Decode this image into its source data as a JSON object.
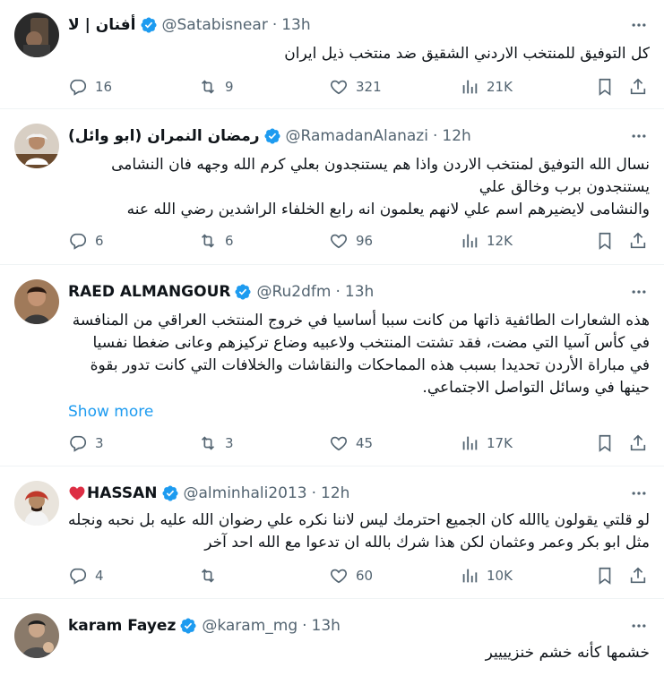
{
  "colors": {
    "accent": "#1d9bf0",
    "secondary_text": "#536471",
    "divider": "#eff3f4",
    "heart": "#f91880"
  },
  "tweets": [
    {
      "display_name": "أفنان | لا",
      "handle": "@Satabisnear",
      "dot": "·",
      "time": "13h",
      "text": "كل التوفيق للمنتخب الاردني الشقيق ضد منتخب ذيل ايران",
      "show_more": "",
      "replies": "16",
      "retweets": "9",
      "likes": "321",
      "views": "21K"
    },
    {
      "display_name": "رمضان النمران (ابو وائل)",
      "handle": "@RamadanAlanazi",
      "dot": "·",
      "time": "12h",
      "text": "نسال الله التوفيق لمنتخب الاردن واذا هم يستنجدون بعلي كرم الله وجهه فان النشامى يستنجدون برب وخالق علي\nوالنشامى لايضيرهم اسم علي لانهم يعلمون انه رابع الخلفاء الراشدين رضي الله عنه",
      "show_more": "",
      "replies": "6",
      "retweets": "6",
      "likes": "96",
      "views": "12K"
    },
    {
      "display_name": "RAED ALMANGOUR",
      "handle": "@Ru2dfm",
      "dot": "·",
      "time": "13h",
      "text": "هذه الشعارات الطائفية ذاتها من كانت سببا أساسيا في خروج المنتخب العراقي من المنافسة في كأس آسيا التي مضت، فقد تشتت المنتخب ولاعبيه وضاع تركيزهم وعانى ضغطا نفسيا في مباراة الأردن تحديدا بسبب هذه المماحكات والنقاشات والخلافات التي كانت تدور بقوة حينها في وسائل التواصل الاجتماعي.",
      "show_more": "Show more",
      "replies": "3",
      "retweets": "3",
      "likes": "45",
      "views": "17K"
    },
    {
      "display_name": "HASSAN",
      "name_emoji": "heart",
      "handle": "@alminhali2013",
      "dot": "·",
      "time": "12h",
      "text": "لو قلتي يقولون ياالله كان الجميع احترمك ليس لاننا نكره علي رضوان الله عليه بل نحبه ونجله مثل ابو بكر وعمر وعثمان لكن هذا شرك بالله ان تدعوا مع الله احد آخر",
      "show_more": "",
      "replies": "4",
      "retweets": "",
      "likes": "60",
      "views": "10K"
    },
    {
      "display_name": "karam Fayez",
      "handle": "@karam_mg",
      "dot": "·",
      "time": "13h",
      "text": "خشمها كأنه خشم خنزيييير",
      "show_more": "",
      "replies": "",
      "retweets": "",
      "likes": "",
      "views": ""
    }
  ]
}
